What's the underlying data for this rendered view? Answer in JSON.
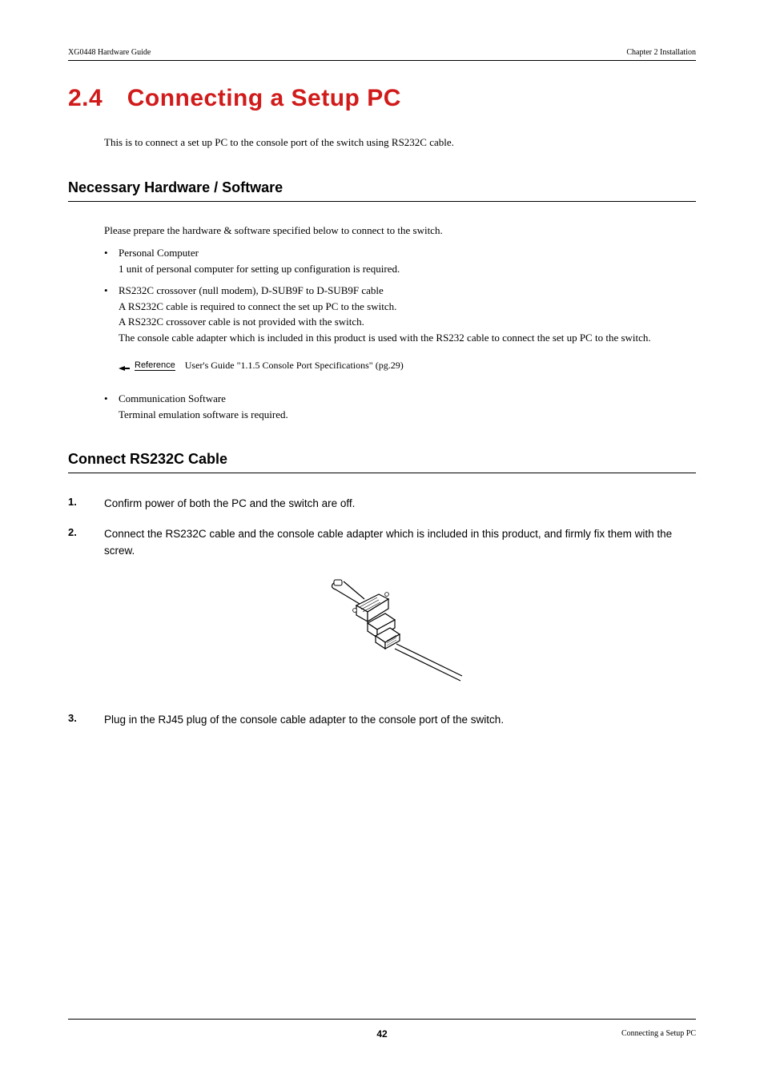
{
  "header": {
    "left": "XG0448 Hardware Guide",
    "right": "Chapter 2 Installation"
  },
  "main_heading": "2.4 Connecting a Setup PC",
  "intro": "This is to connect a set up PC to the console port of the switch using RS232C cable.",
  "section1": {
    "heading": "Necessary Hardware / Software",
    "intro": "Please prepare the hardware & software specified below to connect to the switch.",
    "bullets": [
      {
        "title": "Personal Computer",
        "body": "1 unit of personal computer for setting up configuration is required."
      },
      {
        "title": "RS232C crossover (null modem), D-SUB9F to D-SUB9F cable",
        "body": "A RS232C cable is required to connect the set up PC to the switch.\nA RS232C crossover cable is not provided with the switch.\nThe console cable adapter which is included in this product is used with the RS232 cable to connect the set up PC to the switch."
      }
    ],
    "reference": {
      "label": "Reference",
      "text": "User's Guide \"1.1.5 Console Port Specifications\" (pg.29)"
    },
    "bullets2": [
      {
        "title": "Communication Software",
        "body": "Terminal emulation software is required."
      }
    ]
  },
  "section2": {
    "heading": "Connect RS232C Cable",
    "steps": [
      {
        "num": "1.",
        "text": "Confirm power of both the PC and the switch are off."
      },
      {
        "num": "2.",
        "text": "Connect the RS232C cable and the console cable adapter which is included in this product, and firmly fix them with the screw."
      },
      {
        "num": "3.",
        "text": "Plug in the RJ45 plug of the console cable adapter to the console port of the switch."
      }
    ]
  },
  "footer": {
    "page": "42",
    "right": "Connecting a Setup PC"
  }
}
